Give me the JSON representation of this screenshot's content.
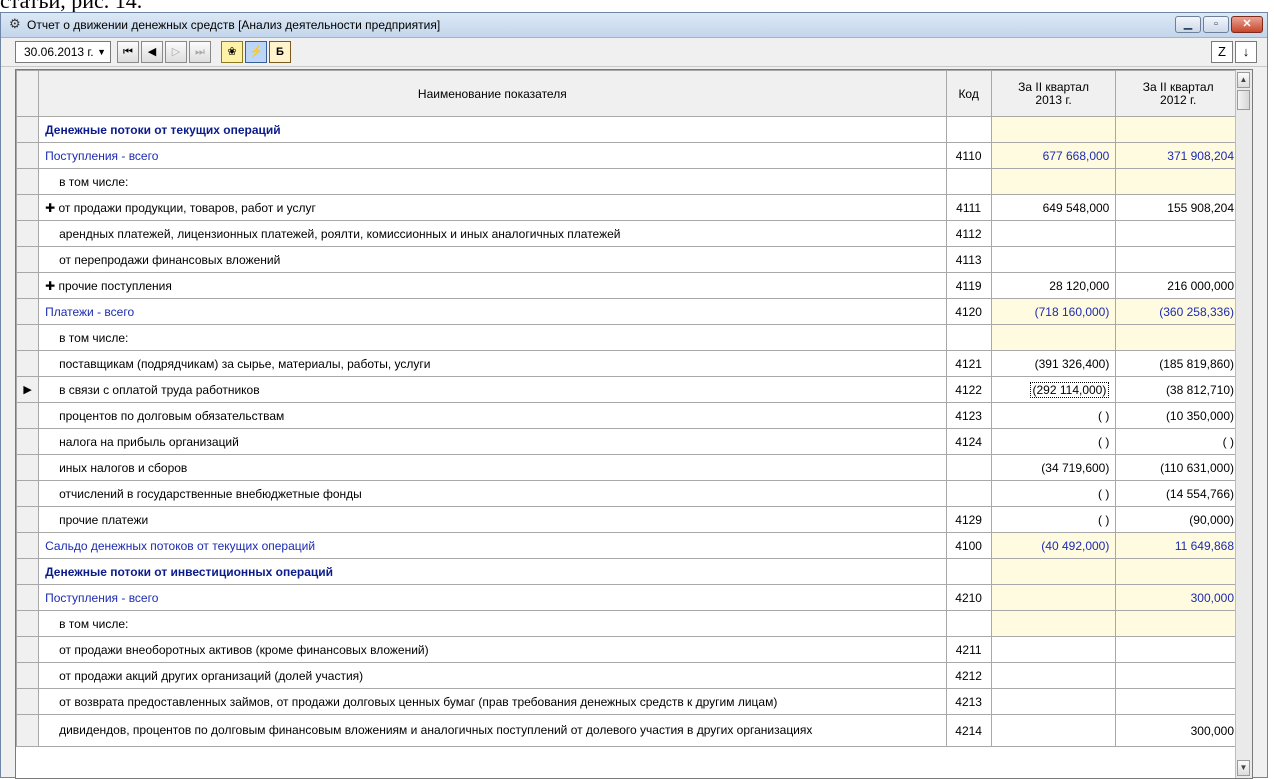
{
  "doc_snippet": "статьи, рис. 14.",
  "window": {
    "title": "Отчет о движении денежных средств [Анализ деятельности предприятия]",
    "icon": "gear-icon",
    "controls": [
      "minimize-icon",
      "maximize-icon",
      "close-icon"
    ]
  },
  "toolbar": {
    "date": "30.06.2013 г.",
    "nav_first": "first-record-icon",
    "nav_prev": "prev-record-icon",
    "nav_next": "next-record-icon",
    "nav_last": "last-record-icon",
    "tool1": "analysis-icon",
    "tool2": "calculator-icon",
    "tool3": "balance-icon",
    "right1_glyph": "Z",
    "right2_glyph": "↓"
  },
  "table": {
    "headers": {
      "name": "Наименование показателя",
      "code": "Код",
      "col1_line1": "За II квартал",
      "col1_line2": "2013 г.",
      "col2_line1": "За II квартал",
      "col2_line2": "2012 г."
    },
    "rows": [
      {
        "name": "Денежные потоки от текущих операций",
        "code": "",
        "v1": "",
        "v2": "",
        "type": "hdr"
      },
      {
        "name": "Поступления - всего",
        "code": "4110",
        "v1": "677 668,000",
        "v2": "371 908,204",
        "type": "tot"
      },
      {
        "name": "в том числе:",
        "code": "",
        "v1": "",
        "v2": "",
        "type": "sub"
      },
      {
        "name": "✚ от продажи продукции, товаров, работ и услуг",
        "code": "4111",
        "v1": "649 548,000",
        "v2": "155 908,204",
        "type": "plain"
      },
      {
        "name": "арендных платежей, лицензионных платежей, роялти, комиссионных и иных аналогичных платежей",
        "code": "4112",
        "v1": "",
        "v2": "",
        "type": "sub"
      },
      {
        "name": "от перепродажи финансовых вложений",
        "code": "4113",
        "v1": "",
        "v2": "",
        "type": "sub"
      },
      {
        "name": "✚ прочие поступления",
        "code": "4119",
        "v1": "28 120,000",
        "v2": "216 000,000",
        "type": "plain"
      },
      {
        "name": "Платежи - всего",
        "code": "4120",
        "v1": "(718 160,000)",
        "v2": "(360 258,336)",
        "type": "tot"
      },
      {
        "name": "в том числе:",
        "code": "",
        "v1": "",
        "v2": "",
        "type": "sub"
      },
      {
        "name": "поставщикам (подрядчикам) за сырье, материалы, работы, услуги",
        "code": "4121",
        "v1": "(391 326,400)",
        "v2": "(185 819,860)",
        "type": "sub"
      },
      {
        "name": "в связи с оплатой труда работников",
        "code": "4122",
        "v1": "(292 114,000)",
        "v2": "(38 812,710)",
        "type": "sub",
        "current": true
      },
      {
        "name": "процентов по долговым обязательствам",
        "code": "4123",
        "v1": "( )",
        "v2": "(10 350,000)",
        "type": "sub"
      },
      {
        "name": "налога на прибыль организаций",
        "code": "4124",
        "v1": "( )",
        "v2": "( )",
        "type": "sub"
      },
      {
        "name": "иных налогов и сборов",
        "code": "",
        "v1": "(34 719,600)",
        "v2": "(110 631,000)",
        "type": "sub"
      },
      {
        "name": "отчислений в государственные внебюджетные фонды",
        "code": "",
        "v1": "( )",
        "v2": "(14 554,766)",
        "type": "sub"
      },
      {
        "name": "прочие платежи",
        "code": "4129",
        "v1": "( )",
        "v2": "(90,000)",
        "type": "sub"
      },
      {
        "name": "Сальдо денежных потоков от текущих операций",
        "code": "4100",
        "v1": "(40 492,000)",
        "v2": "11 649,868",
        "type": "tot"
      },
      {
        "name": "Денежные потоки от инвестиционных операций",
        "code": "",
        "v1": "",
        "v2": "",
        "type": "hdr"
      },
      {
        "name": "Поступления - всего",
        "code": "4210",
        "v1": "",
        "v2": "300,000",
        "type": "tot"
      },
      {
        "name": "в том числе:",
        "code": "",
        "v1": "",
        "v2": "",
        "type": "sub"
      },
      {
        "name": "от продажи внеоборотных активов (кроме финансовых вложений)",
        "code": "4211",
        "v1": "",
        "v2": "",
        "type": "sub"
      },
      {
        "name": "от продажи акций других организаций (долей участия)",
        "code": "4212",
        "v1": "",
        "v2": "",
        "type": "sub"
      },
      {
        "name": "от возврата предоставленных займов, от продажи долговых ценных бумаг (прав требования денежных средств к другим лицам)",
        "code": "4213",
        "v1": "",
        "v2": "",
        "type": "sub"
      },
      {
        "name": "дивидендов, процентов по долговым финансовым вложениям и аналогичных поступлений от долевого участия в других организациях",
        "code": "4214",
        "v1": "",
        "v2": "300,000",
        "type": "multi"
      }
    ]
  },
  "colors": {
    "header_text": "#0a1b8a",
    "total_text": "#1c2bb0",
    "highlight_cell": "#fffbe0"
  }
}
